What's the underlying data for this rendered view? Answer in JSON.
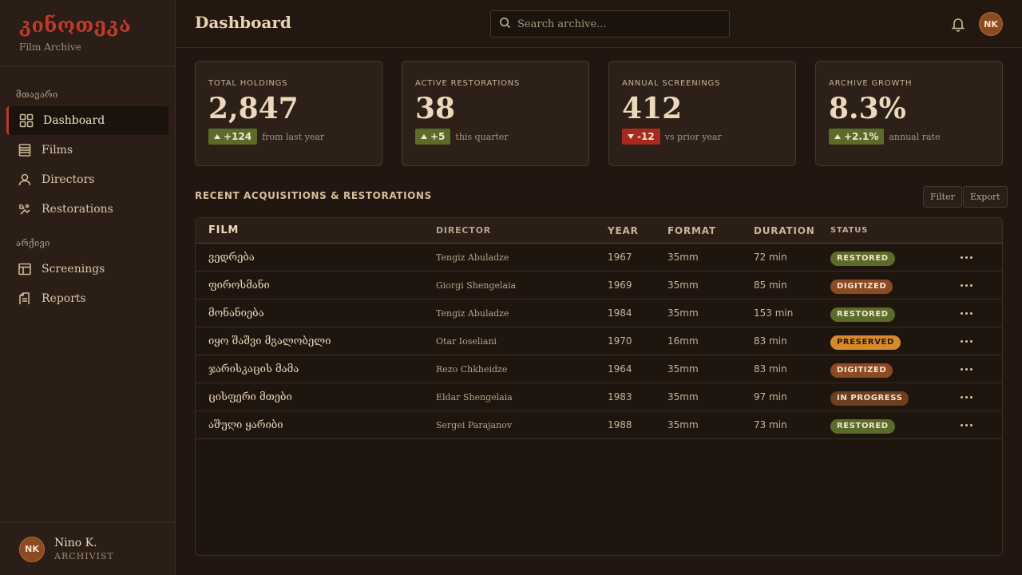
{
  "brand": {
    "name": "კინოთეკა",
    "subtitle": "Film Archive"
  },
  "sidebar": {
    "section_main": "მთავარი",
    "section_archive": "არქივი",
    "items": [
      {
        "label": "Dashboard",
        "icon": "grid-icon",
        "active": true
      },
      {
        "label": "Films",
        "icon": "film-list-icon"
      },
      {
        "label": "Directors",
        "icon": "user-icon"
      },
      {
        "label": "Restorations",
        "icon": "restore-icon"
      },
      {
        "label": "Screenings",
        "icon": "calendar-table-icon"
      },
      {
        "label": "Reports",
        "icon": "report-icon"
      }
    ],
    "user": {
      "initials": "NK",
      "name": "Nino K.",
      "role": "ARCHIVIST"
    }
  },
  "header": {
    "title": "Dashboard",
    "search_placeholder": "Search archive...",
    "avatar_initials": "NK"
  },
  "stats": [
    {
      "label": "TOTAL HOLDINGS",
      "value": "2,847",
      "delta": "+124",
      "direction": "up",
      "note": "from last year"
    },
    {
      "label": "ACTIVE RESTORATIONS",
      "value": "38",
      "delta": "+5",
      "direction": "up",
      "note": "this quarter"
    },
    {
      "label": "ANNUAL SCREENINGS",
      "value": "412",
      "delta": "-12",
      "direction": "down",
      "note": "vs prior year"
    },
    {
      "label": "ARCHIVE GROWTH",
      "value": "8.3%",
      "delta": "+2.1%",
      "direction": "up",
      "note": "annual rate"
    }
  ],
  "section": {
    "title": "RECENT ACQUISITIONS & RESTORATIONS",
    "filter_label": "Filter",
    "export_label": "Export"
  },
  "table": {
    "columns": [
      "FILM",
      "DIRECTOR",
      "YEAR",
      "FORMAT",
      "DURATION",
      "STATUS"
    ],
    "rows": [
      {
        "film": "ვედრება",
        "director": "Tengiz Abuladze",
        "year": "1967",
        "format": "35mm",
        "duration": "72 min",
        "status": "RESTORED"
      },
      {
        "film": "ფიროსმანი",
        "director": "Giorgi Shengelaia",
        "year": "1969",
        "format": "35mm",
        "duration": "85 min",
        "status": "DIGITIZED"
      },
      {
        "film": "მონანიება",
        "director": "Tengiz Abuladze",
        "year": "1984",
        "format": "35mm",
        "duration": "153 min",
        "status": "RESTORED"
      },
      {
        "film": "იყო შაშვი მგალობელი",
        "director": "Otar Ioseliani",
        "year": "1970",
        "format": "16mm",
        "duration": "83 min",
        "status": "PRESERVED"
      },
      {
        "film": "ჯარისკაცის მამა",
        "director": "Rezo Chkheidze",
        "year": "1964",
        "format": "35mm",
        "duration": "83 min",
        "status": "DIGITIZED"
      },
      {
        "film": "ცისფერი მთები",
        "director": "Eldar Shengelaia",
        "year": "1983",
        "format": "35mm",
        "duration": "97 min",
        "status": "IN PROGRESS"
      },
      {
        "film": "აშუღი ყარიბი",
        "director": "Sergei Parajanov",
        "year": "1988",
        "format": "35mm",
        "duration": "73 min",
        "status": "RESTORED"
      }
    ]
  },
  "colors": {
    "accent": "#c0392b",
    "restored": "#5c6b2a",
    "digitized": "#8b4a22",
    "preserved": "#d68a2a",
    "in_progress": "#6e3f1f"
  }
}
